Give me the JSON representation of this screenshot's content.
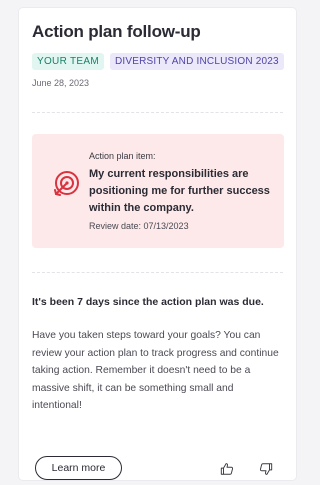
{
  "card": {
    "title": "Action plan follow-up",
    "tags": [
      "YOUR TEAM",
      "DIVERSITY AND INCLUSION 2023"
    ],
    "date": "June 28, 2023"
  },
  "action_plan": {
    "label": "Action plan item:",
    "statement": "My current responsibilities are positioning me for further success within the company.",
    "review_date": "Review date: 07/13/2023",
    "icon": "target-icon",
    "icon_color": "#d9333f",
    "background": "#fde9e9"
  },
  "message": {
    "heading": "It's been 7 days since the action plan was due.",
    "body": "Have you taken steps toward your goals? You can review your action plan to track progress and continue taking action. Remember it doesn't need to be a massive shift, it can be something small and intentional!"
  },
  "actions": {
    "learn_more_label": "Learn more",
    "thumbs_up_icon": "thumbs-up-icon",
    "thumbs_down_icon": "thumbs-down-icon"
  }
}
